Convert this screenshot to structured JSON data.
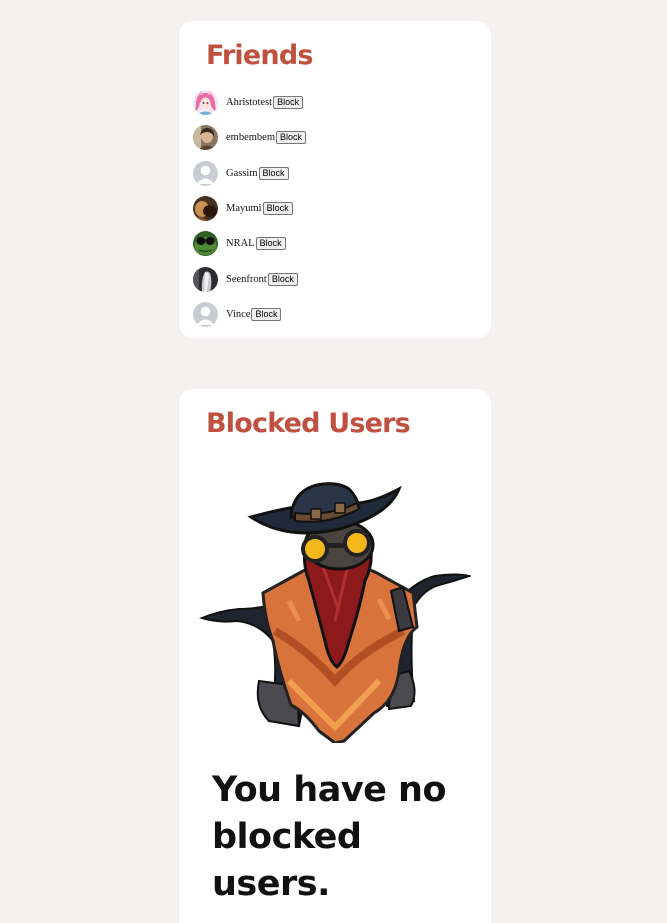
{
  "friends": {
    "title": "Friends",
    "block_label": "Block",
    "list": [
      {
        "name": "Ahristotest",
        "avatar": "pink-anime-avatar"
      },
      {
        "name": "embembem",
        "avatar": "photo-avatar"
      },
      {
        "name": "Gassim",
        "avatar": "default-user-icon"
      },
      {
        "name": "Mayumi",
        "avatar": "photo-avatar"
      },
      {
        "name": "NRAL",
        "avatar": "green-frog-avatar"
      },
      {
        "name": "Seenfront",
        "avatar": "dark-figure-avatar"
      },
      {
        "name": "Vince",
        "avatar": "default-user-icon"
      }
    ]
  },
  "blocked": {
    "title": "Blocked Users",
    "image": "shrugging-cowboy-illustration",
    "empty_message": "You have no blocked users."
  },
  "colors": {
    "page_background": "#f4f1f0",
    "card_background": "#ffffff",
    "heading_accent": "#c0503f",
    "default_avatar": "#c9ccd3"
  }
}
